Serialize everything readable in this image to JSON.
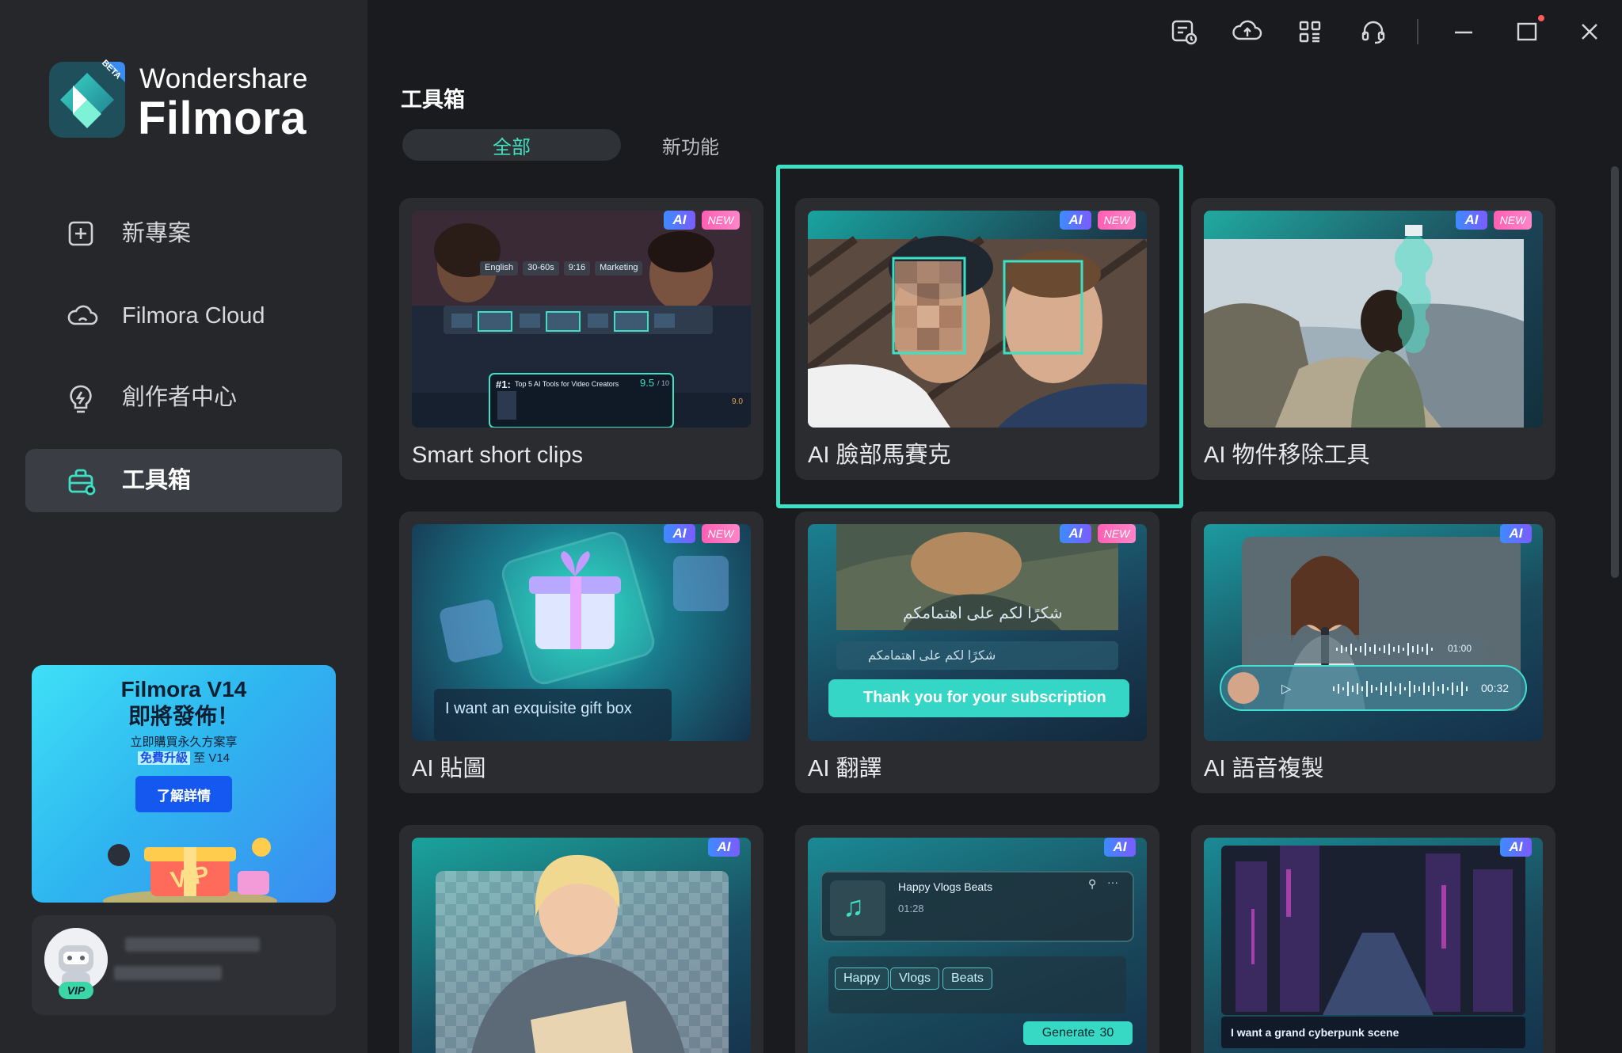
{
  "app": {
    "brand_line1": "Wondershare",
    "brand_line2": "Filmora",
    "beta_badge": "BETA"
  },
  "sidebar": {
    "items": [
      {
        "label": "新專案",
        "icon": "plus-square-icon"
      },
      {
        "label": "Filmora Cloud",
        "icon": "cloud-icon"
      },
      {
        "label": "創作者中心",
        "icon": "lightbulb-icon"
      },
      {
        "label": "工具箱",
        "icon": "toolbox-icon",
        "active": true
      }
    ],
    "promo": {
      "title_line1": "Filmora V14",
      "title_line2": "即將發佈！",
      "sub_line1": "立即購買永久方案享",
      "sub_highlight": "免費升級",
      "sub_line2_rest": " 至 V14",
      "button": "了解詳情"
    },
    "user": {
      "badge": "VIP"
    }
  },
  "titlebar": {
    "icons": [
      "task-list-icon",
      "cloud-upload-icon",
      "apps-grid-icon",
      "headset-icon",
      "minimize-icon",
      "maximize-icon",
      "close-icon"
    ]
  },
  "main": {
    "title": "工具箱",
    "tabs": [
      "全部",
      "新功能"
    ],
    "cards": [
      {
        "label": "Smart short clips",
        "ai": true,
        "new": true
      },
      {
        "label": "AI 臉部馬賽克",
        "ai": true,
        "new": true,
        "selected": true
      },
      {
        "label": "AI 物件移除工具",
        "ai": true,
        "new": true
      },
      {
        "label": "AI 貼圖",
        "ai": true,
        "new": true
      },
      {
        "label": "AI 翻譯",
        "ai": true,
        "new": true
      },
      {
        "label": "AI 語音複製",
        "ai": true,
        "new": false
      },
      {
        "label": "",
        "ai": true,
        "new": false
      },
      {
        "label": "",
        "ai": true,
        "new": false
      },
      {
        "label": "",
        "ai": true,
        "new": false
      }
    ],
    "badge_ai": "AI",
    "badge_new": "NEW"
  },
  "thumbs": {
    "smart_clips": {
      "tags": [
        "English",
        "30-60s",
        "9:16",
        "Marketing"
      ],
      "rank": "#1:",
      "headline": "Top 5 AI Tools for Video Creators",
      "score": "9.5",
      "score_of": "/ 10",
      "score2": "9.0"
    },
    "sticker": {
      "prompt": "I want an exquisite gift box"
    },
    "translate": {
      "arabic_caption": "شكرًا لكم على اهتمامكم",
      "arabic_input": "شكرًا لكم على اهتمامكم",
      "english_output": "Thank you for your subscription"
    },
    "voice_clone": {
      "time1": "01:00",
      "time2": "00:32"
    },
    "music": {
      "track": "Happy Vlogs Beats",
      "time": "01:28",
      "chips": [
        "Happy",
        "Vlogs",
        "Beats"
      ],
      "generate": "Generate",
      "credits": "30"
    },
    "cyberpunk": {
      "prompt": "I want a grand cyberpunk scene"
    }
  },
  "colors": {
    "accent": "#3ee0c4",
    "sidebar_bg": "#25272b",
    "main_bg": "#1a1b1e",
    "card_bg": "#2a2c30"
  }
}
